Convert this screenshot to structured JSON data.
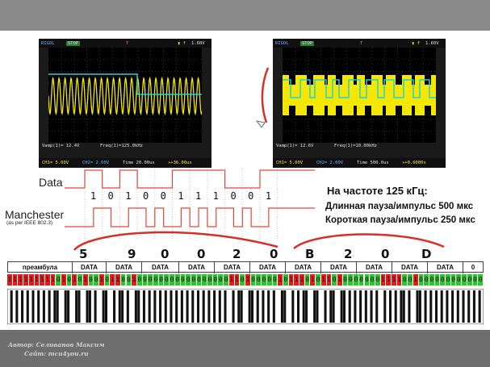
{
  "colors": {
    "cyan": "#1fd0dc",
    "yellow": "#f5e800",
    "red": "#e31b1b",
    "green": "#2ec42e",
    "redline": "#e0483a",
    "brand_blue": "#6fb2ff"
  },
  "scope_left": {
    "brand": "RIGOL",
    "status": "STOP",
    "trig_level": "1.60V",
    "ch1": "CH1= 5.00V",
    "ch2": "CH2= 2.00V",
    "meas_vamp": "Vamp(1)= 12.4V",
    "meas_freq": "Freq(1)=125.0kHz",
    "time": "Time 20.00us",
    "offset": "»+36.00us"
  },
  "scope_right": {
    "brand": "RIGOL",
    "status": "STOP",
    "trig_level": "1.60V",
    "ch1": "CH1= 5.00V",
    "ch2": "CH2= 2.00V",
    "meas_vamp": "Vamp(1)= 12.6V",
    "meas_freq": "Freq(1)=10.00kHz",
    "time": "Time 500.0us",
    "offset": "»+0.0000s"
  },
  "diagram": {
    "data_label": "Data",
    "manchester_label": "Manchester",
    "manchester_sub": "(as per IEEE 802.3)",
    "bits": [
      "1",
      "0",
      "1",
      "0",
      "0",
      "1",
      "1",
      "1",
      "0",
      "0",
      "1"
    ]
  },
  "info": {
    "line1": "На частоте 125 кГц:",
    "line2": "Длинная пауза/импульс 500 мкс",
    "line3": "Короткая пауза/импульс 250 мкс"
  },
  "hex_digits": [
    "5",
    "9",
    "0",
    "0",
    "2",
    "0",
    "B",
    "2",
    "0",
    "D"
  ],
  "frame": {
    "preamble": "преамбула",
    "data_label": "DATA",
    "end_bit": "0",
    "bits": "111111111010101001011001000000000000000001101000001011101011010000000111100100000",
    "bits_visible_count": 88
  },
  "footer": {
    "author": "Автор: Селиванов Максим",
    "site": "Сайт: mcu4you.ru"
  }
}
